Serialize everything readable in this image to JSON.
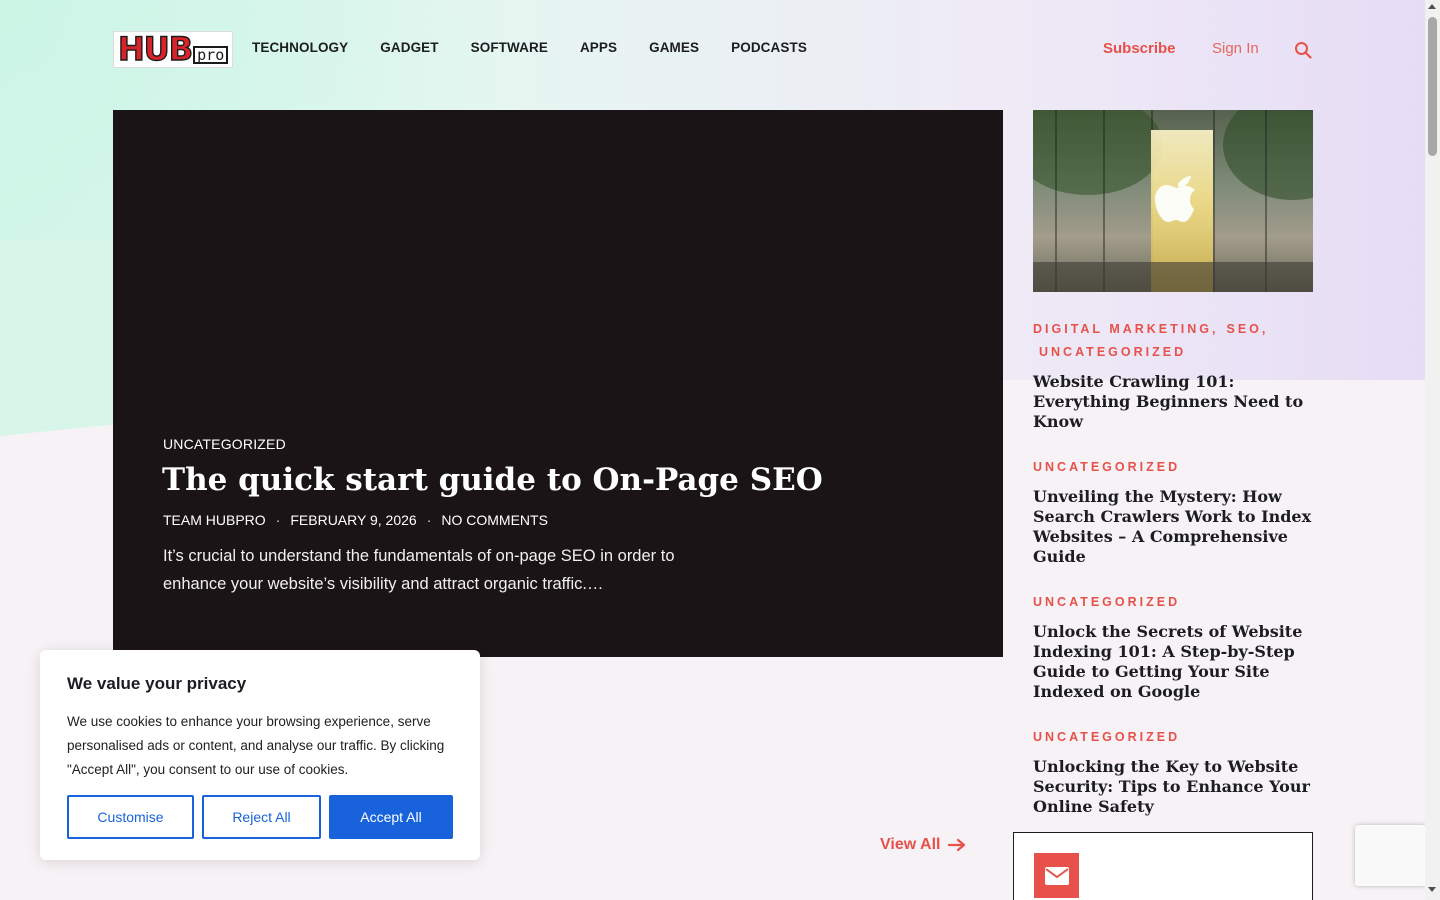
{
  "brand": {
    "logo_main": "HUB",
    "logo_sub": "pro"
  },
  "nav": {
    "items": [
      {
        "label": "TECHNOLOGY"
      },
      {
        "label": "GADGET"
      },
      {
        "label": "SOFTWARE"
      },
      {
        "label": "APPS"
      },
      {
        "label": "GAMES"
      },
      {
        "label": "PODCASTS"
      }
    ]
  },
  "header": {
    "subscribe_label": "Subscribe",
    "signin_label": "Sign In",
    "search_icon": "search-icon"
  },
  "hero": {
    "category": "UNCATEGORIZED",
    "title": "The quick start guide to On-Page SEO",
    "author": "TEAM HUBPRO",
    "date": "FEBRUARY 9, 2026",
    "comments": "NO COMMENTS",
    "separator": "·",
    "excerpt": "It’s crucial to understand the fundamentals of on-page SEO in order to enhance your website’s visibility and attract organic traffic.…"
  },
  "sidebar": {
    "posts": [
      {
        "categories": [
          "DIGITAL MARKETING,",
          "SEO,",
          "UNCATEGORIZED"
        ],
        "title": "Website Crawling 101: Everything Beginners Need to Know"
      },
      {
        "categories": [
          "UNCATEGORIZED"
        ],
        "title": "Unveiling the Mystery: How Search Crawlers Work to Index Websites – A Comprehensive Guide"
      },
      {
        "categories": [
          "UNCATEGORIZED"
        ],
        "title": "Unlock the Secrets of Website Indexing 101: A Step-by-Step Guide to Getting Your Site Indexed on Google"
      },
      {
        "categories": [
          "UNCATEGORIZED"
        ],
        "title": "Unlocking the Key to Website Security: Tips to Enhance Your Online Safety"
      }
    ]
  },
  "view_all": {
    "label": "View All",
    "icon": "arrow-right-icon"
  },
  "newsletter": {
    "icon": "envelope-icon"
  },
  "cookie": {
    "title": "We value your privacy",
    "text": "We use cookies to enhance your browsing experience, serve personalised ads or content, and analyse our traffic. By clicking \"Accept All\", you consent to our use of cookies.",
    "customise_label": "Customise",
    "reject_label": "Reject All",
    "accept_label": "Accept All"
  },
  "colors": {
    "accent": "#e8514a",
    "cookie_blue": "#1863dc",
    "hero_bg": "#1b1416"
  }
}
